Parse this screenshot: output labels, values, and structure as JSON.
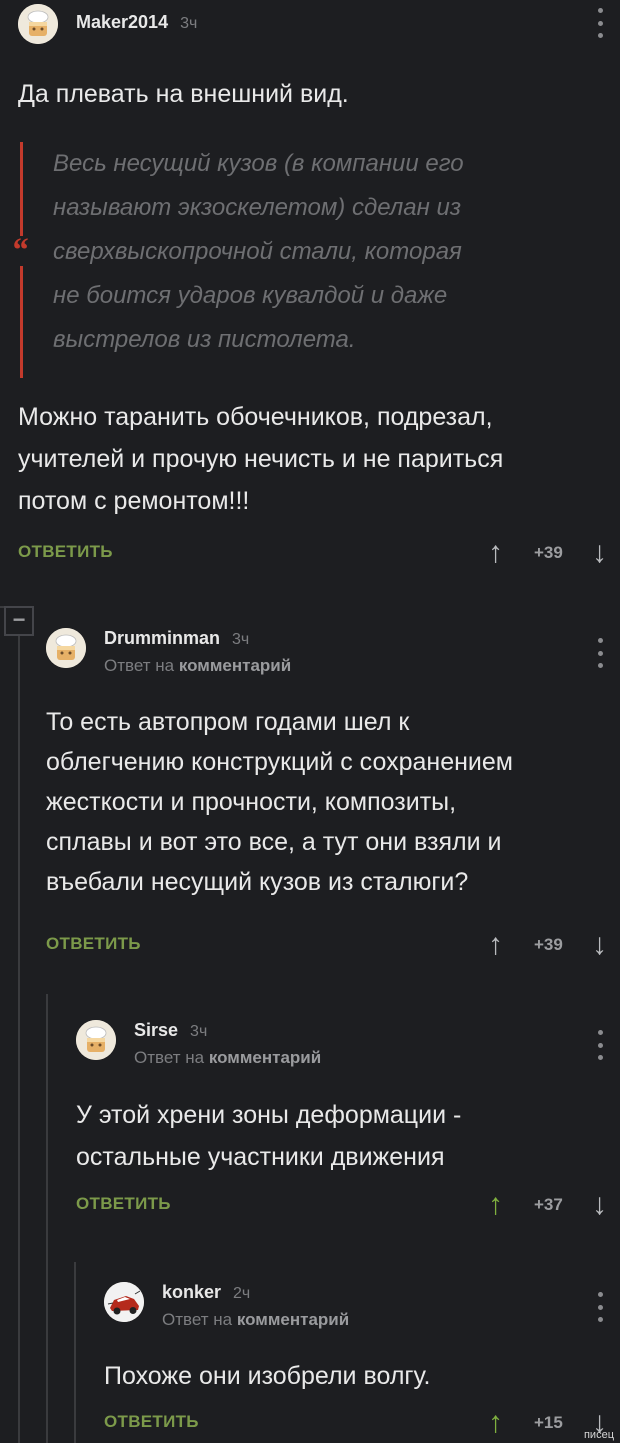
{
  "comments": [
    {
      "username": "Maker2014",
      "time": "3ч",
      "avatar_icon": "chef-cake-avatar",
      "text_before_quote": "Да плевать на внешний вид.",
      "quote_lines": [
        "Весь несущий кузов (в компании его",
        "называют экзоскелетом) сделан из",
        "сверхвыскопрочной стали, которая",
        "не боится ударов кувалдой и даже",
        "выстрелов из пистолета."
      ],
      "text_lines": [
        "Можно таранить обочечников, подрезал,",
        "учителей и прочую нечисть и не париться",
        "потом с ремонтом!!!"
      ],
      "reply_label": "ОТВЕТИТЬ",
      "rating": "+39",
      "upvoted": false
    },
    {
      "username": "Drumminman",
      "time": "3ч",
      "avatar_icon": "chef-cake-avatar",
      "reply_prefix": "Ответ на",
      "reply_target": "комментарий",
      "text_lines": [
        "То есть автопром годами шел к",
        "облегчению конструкций с сохранением",
        "жесткости и прочности, композиты,",
        "сплавы и вот это все, а тут они взяли и",
        "въебали несущий кузов из сталюги?"
      ],
      "reply_label": "ОТВЕТИТЬ",
      "rating": "+39",
      "upvoted": false
    },
    {
      "username": "Sirse",
      "time": "3ч",
      "avatar_icon": "chef-cake-avatar",
      "reply_prefix": "Ответ на",
      "reply_target": "комментарий",
      "text_lines": [
        "У этой хрени зоны деформации -",
        "остальные участники движения"
      ],
      "reply_label": "ОТВЕТИТЬ",
      "rating": "+37",
      "upvoted": true
    },
    {
      "username": "konker",
      "time": "2ч",
      "avatar_icon": "red-car-avatar",
      "reply_prefix": "Ответ на",
      "reply_target": "комментарий",
      "text_lines": [
        "Похоже они изобрели волгу."
      ],
      "reply_label": "ОТВЕТИТЬ",
      "rating": "+15",
      "upvoted": true
    }
  ],
  "collapse_symbol": "−",
  "vote_up_glyph": "↑",
  "vote_down_glyph": "↓",
  "watermark": "писец",
  "colors": {
    "background": "#1d1e21",
    "reply_link": "#7c9a4a",
    "upvote_active": "#7fb03f",
    "quote_bar": "#c33a2c"
  }
}
